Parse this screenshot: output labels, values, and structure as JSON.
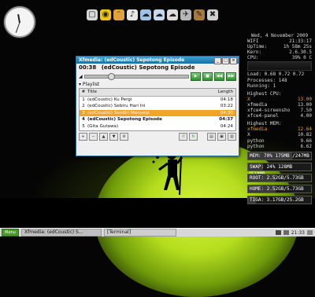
{
  "desktop": {
    "clock_widget": "analog-clock",
    "dock_icons": [
      "terminal-icon",
      "chat-icon",
      "cat-icon",
      "media-icon",
      "network-icon",
      "network-icon",
      "network-icon",
      "bird-icon",
      "gimp-icon",
      "tools-icon"
    ]
  },
  "conky": {
    "date": "Wed, 4 November 2009",
    "rows": [
      {
        "k": "WIFI",
        "v": "21:33:17"
      },
      {
        "k": "UpTime:",
        "v": "1h 58m 25s"
      },
      {
        "k": "Kern:",
        "v": "2.6.30.5"
      },
      {
        "k": "CPU:",
        "v": "39% 0 C"
      }
    ],
    "load": "Load: 0.68 0.72 0.72",
    "processes": "Processes: 148",
    "running": "Running: 1",
    "cpu_header": "Highest CPU:",
    "cpu": [
      {
        "k": "X",
        "v": "13.00",
        "hl": true
      },
      {
        "k": "xfmedia",
        "v": "13.00"
      },
      {
        "k": "xfce4-screensho",
        "v": "7.50"
      },
      {
        "k": "xfce4-panel",
        "v": "4.00"
      }
    ],
    "mem_header": "Highest MEM:",
    "mem": [
      {
        "k": "xfmedia",
        "v": "12.64",
        "hl": true
      },
      {
        "k": "X",
        "v": "10.82"
      },
      {
        "k": "python",
        "v": "9.66"
      },
      {
        "k": "python",
        "v": "6.62"
      }
    ],
    "bars": [
      {
        "label": "MEM: 70% 175MB /247MB",
        "pct": 70
      },
      {
        "label": "SWAP: 24% 128MB /518MB",
        "pct": 24
      },
      {
        "label": "ROOT: 2.52GB/5.73GB",
        "pct": 44
      },
      {
        "label": "HOME: 2.52GB/5.73GB",
        "pct": 44
      },
      {
        "label": "TIGA: 3.17GB/25.2GB",
        "pct": 13
      }
    ]
  },
  "player": {
    "title": "Xfmedia: (edCoustic) Sepotong Episode",
    "now_time": "00:38",
    "now_track": "(edCoustic) Sepotong Episode",
    "seek_fraction": 0.22,
    "playlist_label": "Playlist",
    "col_num": "#",
    "col_title": "Title",
    "col_length": "Length",
    "tracks": [
      {
        "n": "1",
        "title": "(edCoustic) Ku Pergi",
        "len": "04:18"
      },
      {
        "n": "2",
        "title": "(edCoustic) Sebiru Hari Ini",
        "len": "03:22"
      },
      {
        "n": "3",
        "title": "(edCoustic) Sendiri Menyepi",
        "len": "04:30"
      },
      {
        "n": "4",
        "title": "(edCoustic) Sepotong Episode",
        "len": "04:37"
      },
      {
        "n": "5",
        "title": "(Gita Gutawa)",
        "len": "04:24"
      }
    ],
    "selected_index": 2,
    "playing_index": 3
  },
  "taskbar": {
    "menu_label": "Menu",
    "tasks": [
      "Xfmedia: (edCoustic) S...",
      "[Terminal]"
    ],
    "time": "21:33"
  }
}
